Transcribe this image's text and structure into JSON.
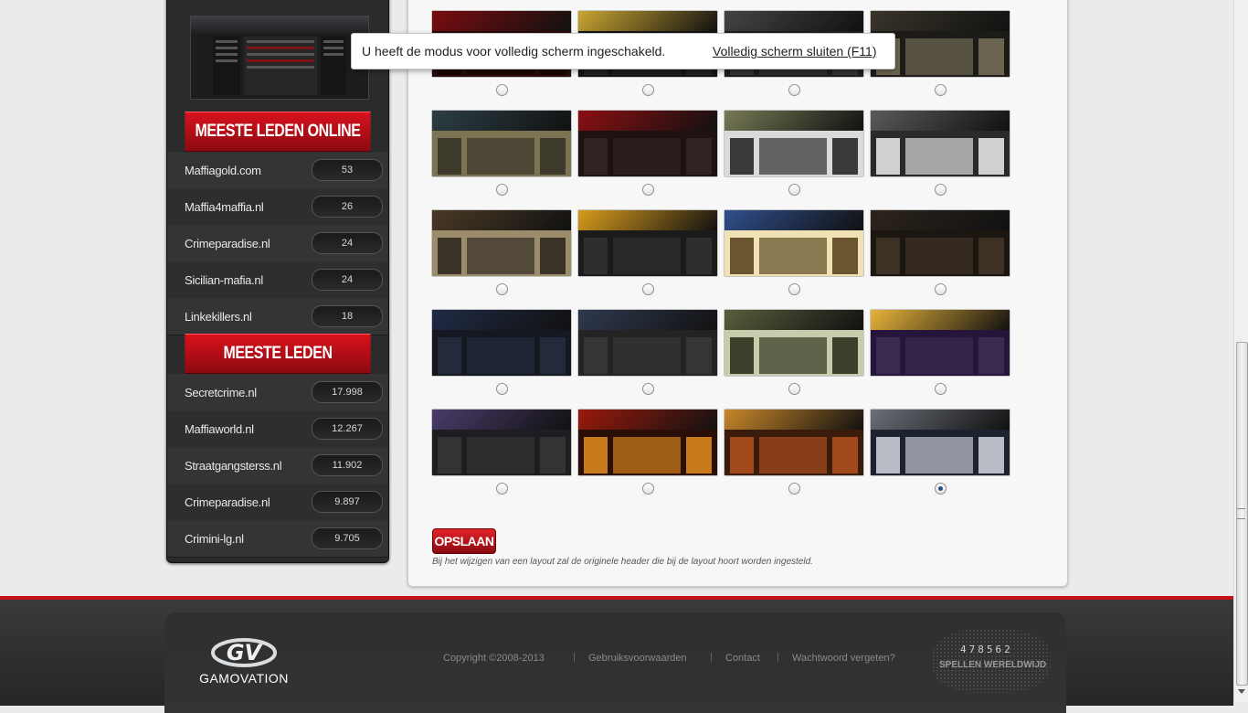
{
  "sidebar": {
    "online_heading": "MEESTE LEDEN ONLINE",
    "online_list": [
      {
        "name": "Maffiagold.com",
        "count": "53"
      },
      {
        "name": "Maffia4maffia.nl",
        "count": "26"
      },
      {
        "name": "Crimeparadise.nl",
        "count": "24"
      },
      {
        "name": "Sicilian-mafia.nl",
        "count": "24"
      },
      {
        "name": "Linkekillers.nl",
        "count": "18"
      }
    ],
    "members_heading": "MEESTE LEDEN",
    "members_list": [
      {
        "name": "Secretcrime.nl",
        "count": "17.998"
      },
      {
        "name": "Maffiaworld.nl",
        "count": "12.267"
      },
      {
        "name": "Straatgangsterss.nl",
        "count": "11.902"
      },
      {
        "name": "Crimeparadise.nl",
        "count": "9.897"
      },
      {
        "name": "Crimini-lg.nl",
        "count": "9.705"
      }
    ]
  },
  "layouts": {
    "selected_index": 19,
    "themes": [
      {
        "header": "#7a0c0f",
        "body": "#2a0a0a",
        "col": "#1a0505"
      },
      {
        "header": "#c9a532",
        "body": "#141414",
        "col": "#222"
      },
      {
        "header": "#444",
        "body": "#1e1e1e",
        "col": "#333"
      },
      {
        "header": "#3a352a",
        "body": "#1c1b18",
        "col": "#6b6450"
      },
      {
        "header": "#2c3f45",
        "body": "#7c7352",
        "col": "#3d3a2c"
      },
      {
        "header": "#8b0f12",
        "body": "#1d1111",
        "col": "#2e2222"
      },
      {
        "header": "#777a55",
        "body": "#dadada",
        "col": "#3a3a3a"
      },
      {
        "header": "#5a5a5a",
        "body": "#2a2a2a",
        "col": "#d0d0d0"
      },
      {
        "header": "#4a3a25",
        "body": "#9b8d6c",
        "col": "#3a3328"
      },
      {
        "header": "#d89c1c",
        "body": "#1b1b1b",
        "col": "#2e2e2e"
      },
      {
        "header": "#2f4f8c",
        "body": "#f0e2b4",
        "col": "#6a5530"
      },
      {
        "header": "#2d241c",
        "body": "#1c1611",
        "col": "#3d3126"
      },
      {
        "header": "#1f2a45",
        "body": "#151821",
        "col": "#222a3b"
      },
      {
        "header": "#2f3a50",
        "body": "#232323",
        "col": "#353535"
      },
      {
        "header": "#5a5d3c",
        "body": "#c8ccac",
        "col": "#3d3f2a"
      },
      {
        "header": "#e8b33a",
        "body": "#26153a",
        "col": "#3a2a50"
      },
      {
        "header": "#4a3b6a",
        "body": "#1e1e22",
        "col": "#333"
      },
      {
        "header": "#9a1a0c",
        "body": "#2a0f08",
        "col": "#c87a1a"
      },
      {
        "header": "#c8872a",
        "body": "#3a1c0c",
        "col": "#a34a1c"
      },
      {
        "header": "#6b6f78",
        "body": "#1d2230",
        "col": "#b9bcc4"
      }
    ]
  },
  "save": {
    "label": "OPSLAAN",
    "note": "Bij het wijzigen van een layout zal de originele header die bij de layout hoort worden ingesteld."
  },
  "fullscreen_toast": {
    "message": "U heeft de modus voor volledig scherm ingeschakeld.",
    "exit_link": "Volledig scherm sluiten (F11)"
  },
  "footer": {
    "logo_text": "GAMOVATION",
    "copyright": "Copyright ©2008-2013",
    "links": [
      "Gebruiksvoorwaarden",
      "Contact",
      "Wachtwoord vergeten?"
    ],
    "counter_digits": "478562",
    "counter_label": "SPELLEN WERELDWIJD"
  },
  "colors": {
    "accent_red": "#c4111a",
    "sidebar_bg": "#2b2b2b",
    "panel_bg": "#f7f7f7"
  }
}
